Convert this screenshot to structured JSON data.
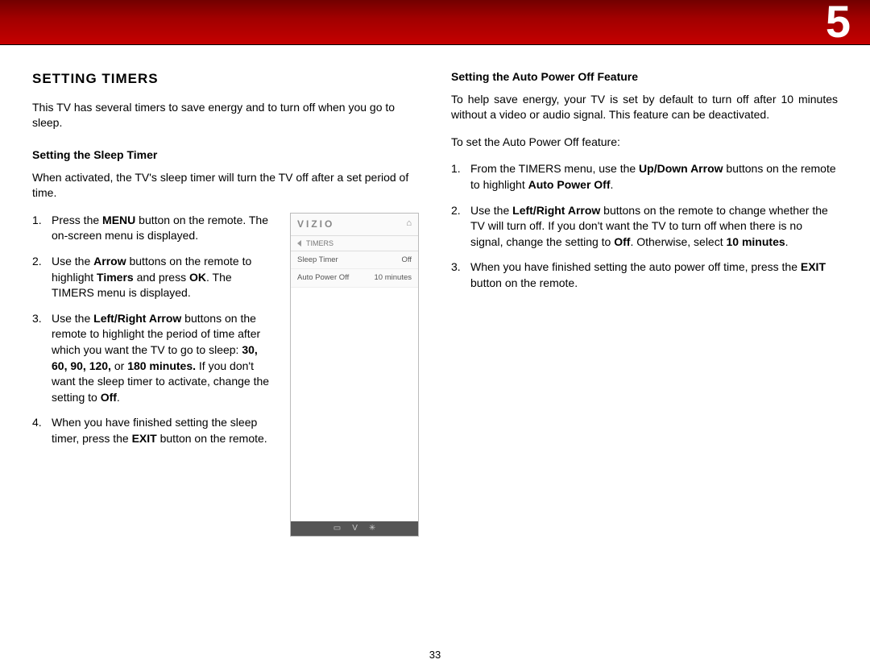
{
  "chapterNumber": "5",
  "pageNumber": "33",
  "left": {
    "title": "SETTING TIMERS",
    "intro": "This TV has several timers to save energy and to turn off when you go to sleep.",
    "subTitle": "Setting the Sleep Timer",
    "subIntro": "When activated, the TV's sleep timer will turn the TV off after a set period of time.",
    "steps": {
      "s1a": "Press the ",
      "s1b": "MENU",
      "s1c": " button on the remote. The on-screen menu is displayed.",
      "s2a": "Use the ",
      "s2b": "Arrow",
      "s2c": " buttons on the remote to highlight ",
      "s2d": "Timers",
      "s2e": " and press ",
      "s2f": "OK",
      "s2g": ". The TIMERS menu is displayed.",
      "s3a": "Use the ",
      "s3b": "Left/Right Arrow",
      "s3c": " buttons on the remote to highlight the period of time after which you want the TV to go to sleep: ",
      "s3d": "30, 60, 90, 120,",
      "s3e": " or ",
      "s3f": "180 minutes.",
      "s3g": " If you don't want the sleep timer to activate, change the setting to ",
      "s3h": "Off",
      "s3i": ".",
      "s4a": "When you have finished setting the sleep timer, press the ",
      "s4b": "EXIT",
      "s4c": " button on the remote."
    }
  },
  "right": {
    "subTitle": "Setting the Auto Power Off Feature",
    "intro": "To help save energy, your TV is set by default to turn off after 10 minutes without a video or audio signal. This feature can be deactivated.",
    "lead": "To set the Auto Power Off feature:",
    "steps": {
      "s1a": "From the TIMERS menu, use the ",
      "s1b": "Up/Down Arrow",
      "s1c": " buttons on the remote to highlight ",
      "s1d": "Auto Power Off",
      "s1e": ".",
      "s2a": "Use the ",
      "s2b": "Left/Right Arrow",
      "s2c": " buttons on the remote to change whether the TV will turn off. If you don't want the TV to turn off when there is no signal, change the setting to ",
      "s2d": "Off",
      "s2e": ". Otherwise, select ",
      "s2f": "10 minutes",
      "s2g": ".",
      "s3a": "When you have finished setting the auto power off time, press the ",
      "s3b": "EXIT",
      "s3c": " button on the remote."
    }
  },
  "panel": {
    "logo": "VIZIO",
    "crumb": "TIMERS",
    "row1Label": "Sleep Timer",
    "row1Value": "Off",
    "row2Label": "Auto Power Off",
    "row2Value": "10 minutes"
  }
}
